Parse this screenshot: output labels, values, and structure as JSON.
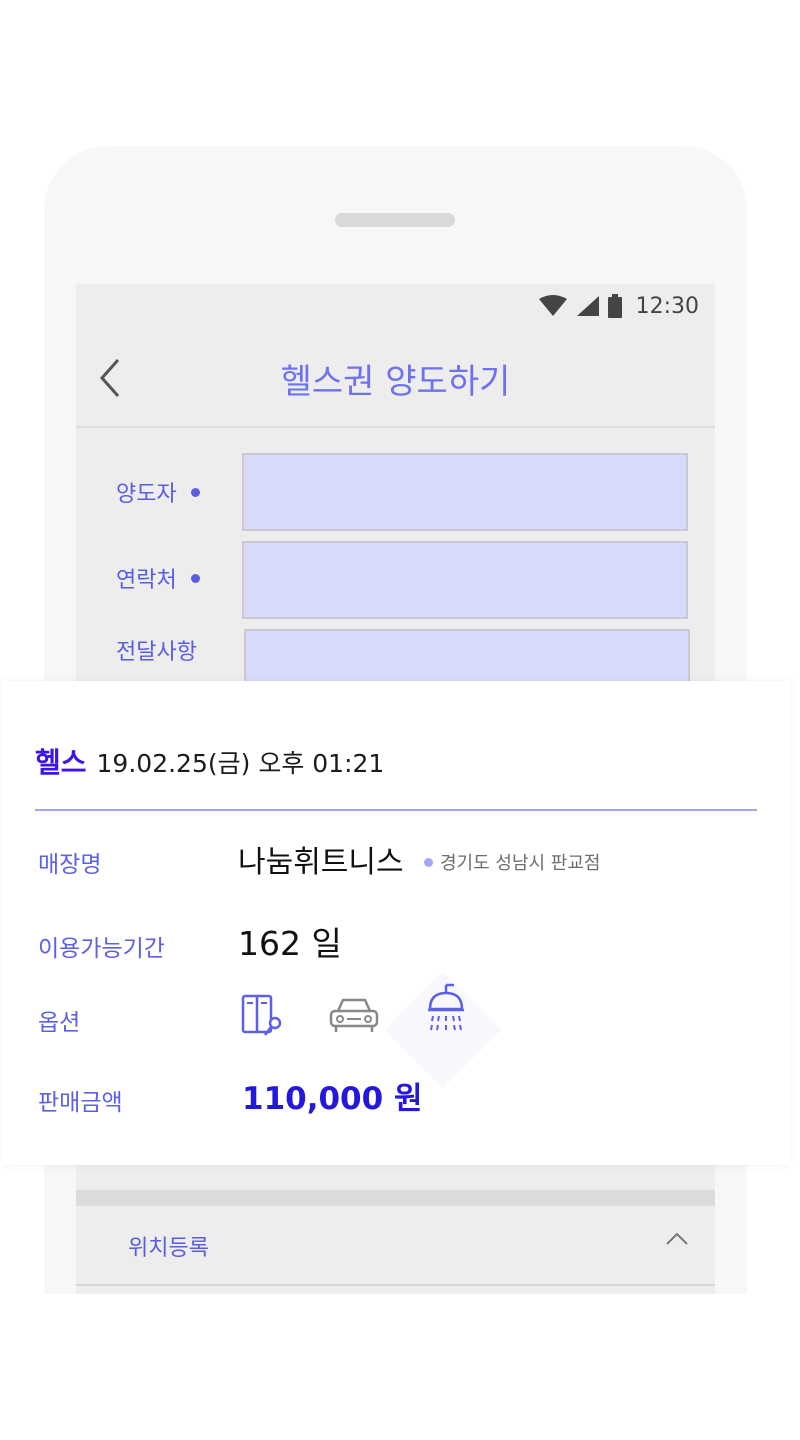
{
  "status_bar": {
    "time": "12:30"
  },
  "app_bar": {
    "title": "헬스권 양도하기",
    "back_icon": "chevron-left-icon"
  },
  "form": {
    "fields": [
      {
        "label": "양도자",
        "required": true,
        "value": ""
      },
      {
        "label": "연락처",
        "required": true,
        "value": ""
      },
      {
        "label": "전달사항",
        "required": false,
        "value": ""
      }
    ]
  },
  "location_section": {
    "label": "위치등록",
    "icon": "chevron-up-icon"
  },
  "card": {
    "category": "헬스",
    "timestamp": "19.02.25(금) 오후 01:21",
    "store_label": "매장명",
    "store_name": "나눔휘트니스",
    "store_location": "경기도 성남시 판교점",
    "period_label": "이용가능기간",
    "period_value": "162 일",
    "options_label": "옵션",
    "options": [
      {
        "icon": "locker-key-icon",
        "active": true
      },
      {
        "icon": "car-icon",
        "active": false
      },
      {
        "icon": "shower-icon",
        "active": true
      }
    ],
    "price_label": "판매금액",
    "price_value": "110,000 원"
  },
  "colors": {
    "accent": "#5c60e8",
    "category": "#3c14e6",
    "price": "#2418dc",
    "input_fill": "#d8dafc"
  }
}
